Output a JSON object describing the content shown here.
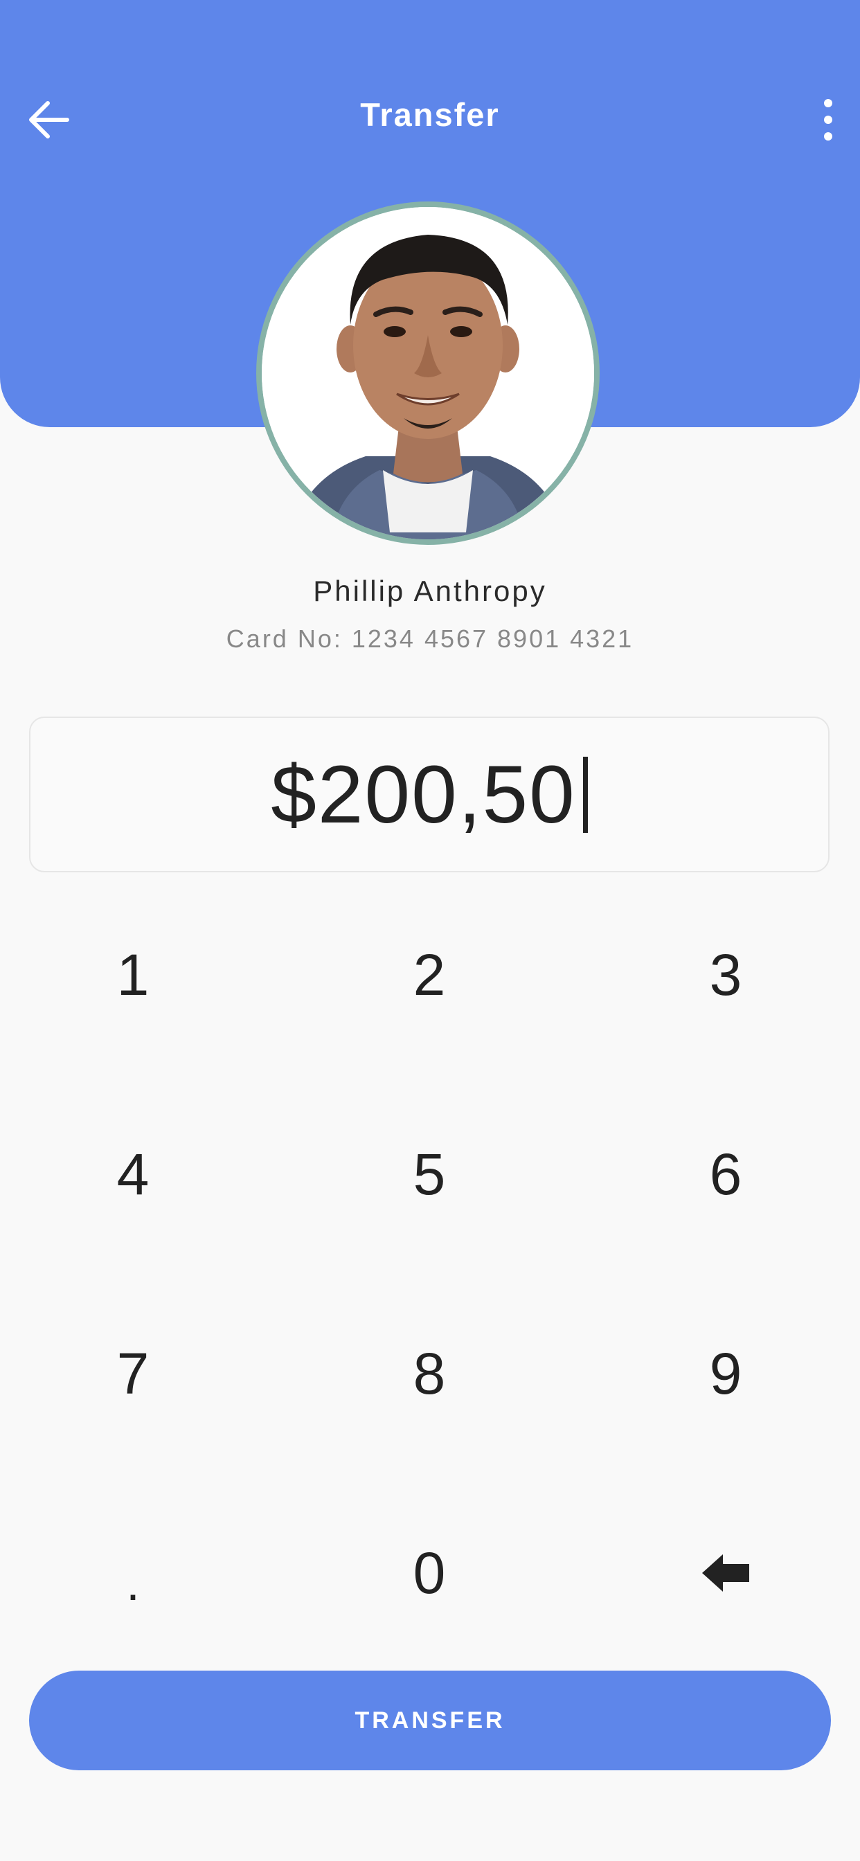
{
  "header": {
    "title": "Transfer",
    "back_icon": "arrow-left-icon",
    "menu_icon": "more-vertical-icon",
    "background_color": "#5e86ea"
  },
  "recipient": {
    "name": "Phillip Anthropy",
    "card_number": "Card No: 1234 4567 8901 4321",
    "avatar": "profile-photo"
  },
  "amount": {
    "value": "$200,50"
  },
  "keypad": {
    "keys": [
      "1",
      "2",
      "3",
      "4",
      "5",
      "6",
      "7",
      "8",
      "9",
      ".",
      "0"
    ],
    "backspace_icon": "backspace-arrow-icon"
  },
  "transfer_button": {
    "label": "TRANSFER",
    "color": "#5e86ea"
  }
}
